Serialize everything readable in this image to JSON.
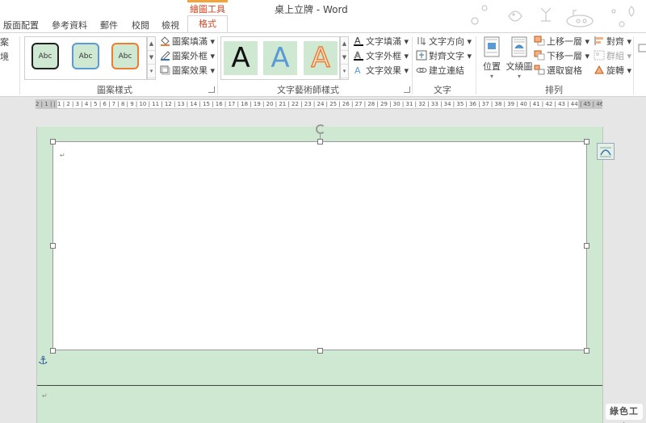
{
  "window": {
    "title": "桌上立牌 - Word"
  },
  "context_tab": "繪圖工具",
  "tabs": [
    {
      "label": "版面配置"
    },
    {
      "label": "參考資料"
    },
    {
      "label": "郵件"
    },
    {
      "label": "校閱"
    },
    {
      "label": "檢視"
    },
    {
      "label": "格式",
      "active": true
    }
  ],
  "ribbon": {
    "partial_left": [
      "案",
      "境"
    ],
    "shape_styles": {
      "label": "圖案樣式",
      "thumbs": [
        {
          "text": "Abc",
          "fill": "#cfe8d2",
          "border": "#222222"
        },
        {
          "text": "Abc",
          "fill": "#cfe8d2",
          "border": "#5b9bd5"
        },
        {
          "text": "Abc",
          "fill": "#cfe8d2",
          "border": "#ed7d31"
        }
      ],
      "commands": [
        "圖案填滿",
        "圖案外框",
        "圖案效果"
      ]
    },
    "wordart_styles": {
      "label": "文字藝術師樣式",
      "letters": [
        {
          "text": "A",
          "color": "#111111"
        },
        {
          "text": "A",
          "color": "#5b9bd5"
        },
        {
          "text": "A",
          "color": "#f4b183"
        }
      ],
      "commands": [
        "文字填滿",
        "文字外框",
        "文字效果"
      ]
    },
    "text": {
      "label": "文字",
      "commands": [
        "文字方向",
        "對齊文字",
        "建立連結"
      ]
    },
    "arrange": {
      "label": "排列",
      "big_buttons": [
        "位置",
        "文繞圖"
      ],
      "commands": [
        "上移一層",
        "下移一層",
        "選取窗格"
      ],
      "commands2": [
        "對齊",
        "群組",
        "旋轉"
      ]
    }
  },
  "ruler": {
    "numbers": "2 | 1 | | 1 | 2 | 3 | 4 | 5 | 6 | 7 | 8 | 9 | 10 | 11 | 12 | 13 | 14 | 15 | 16 | 17 | 18 | 19 | 20 | 21 | 22 | 23 | 24 | 25 | 26 | 27 | 28 | 29 | 30 | 31 | 32 | 33 | 34 | 35 | 36 | 37 | 38 | 39 | 40 | 41 | 42 | 43 | 44 | 45 | 46 | 47"
  },
  "document": {
    "paragraph_mark": "↵",
    "anchor_symbol": "⚓"
  },
  "watermark": "綠色工廠",
  "colors": {
    "accent": "#d24726",
    "page_background": "#cfe8d2",
    "link_blue": "#2b579a"
  }
}
